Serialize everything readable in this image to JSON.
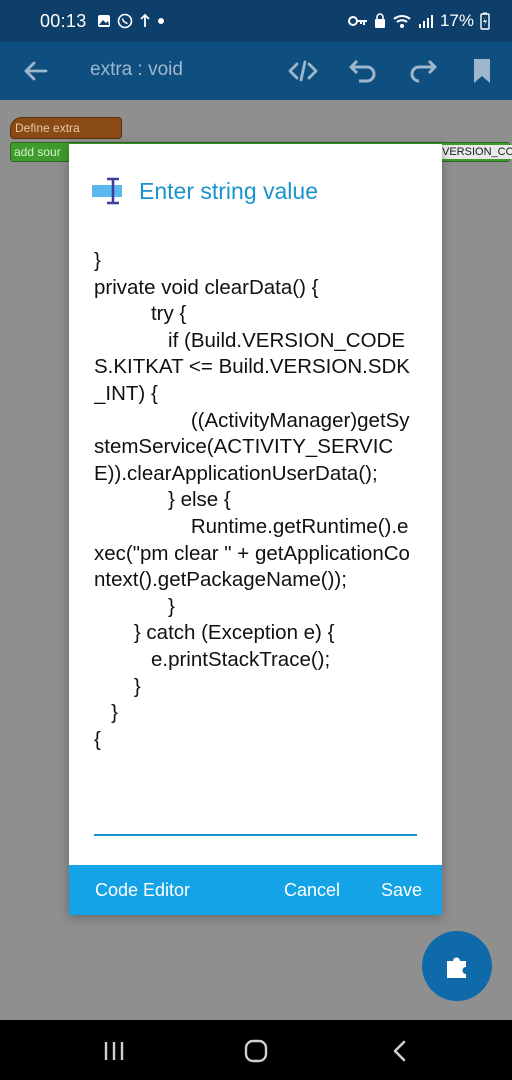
{
  "status_bar": {
    "time": "00:13",
    "battery": "17%"
  },
  "app_bar": {
    "title": "extra : void",
    "icons": [
      "back-icon",
      "code-icon",
      "undo-icon",
      "redo-icon",
      "bookmark-icon"
    ]
  },
  "canvas": {
    "define_block": "Define extra",
    "add_block": "add sour",
    "version_block": "VERSION_CO"
  },
  "dialog": {
    "title": "Enter string value",
    "value": "}\nprivate void clearData() {\n          try {\n             if (Build.VERSION_CODES.KITKAT <= Build.VERSION.SDK_INT) {\n                 ((ActivityManager)getSystemService(ACTIVITY_SERVICE)).clearApplicationUserData();\n             } else {\n                 Runtime.getRuntime().exec(\"pm clear \" + getApplicationContext().getPackageName());\n             }\n       } catch (Exception e) {\n          e.printStackTrace();\n       }\n   }\n{",
    "buttons": {
      "code_editor": "Code Editor",
      "cancel": "Cancel",
      "save": "Save"
    }
  },
  "colors": {
    "status_bar": "#0e3e6a",
    "app_bar": "#0f4f80",
    "accent": "#1793cf",
    "footer": "#14a3e6",
    "fab": "#0e6aa8"
  }
}
